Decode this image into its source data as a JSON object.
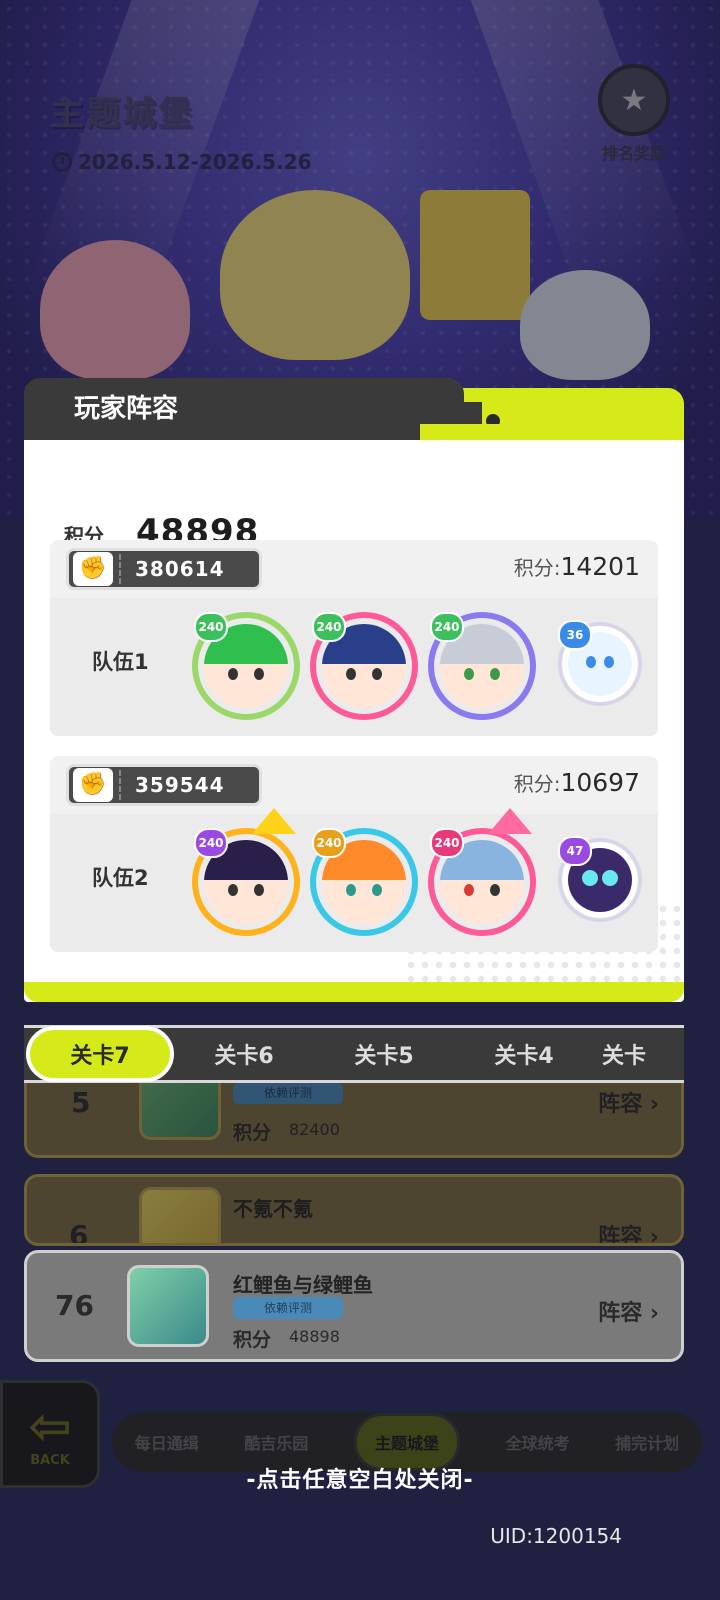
{
  "theme": {
    "title": "主题城堡",
    "date_range": "2026.5.12-2026.5.26",
    "rank_reward_label": "排名奖励"
  },
  "modal": {
    "title": "玩家阵容",
    "total_score_label": "积分",
    "total_score": "48898",
    "teams": [
      {
        "player_id": "380614",
        "score_label": "积分:",
        "score": "14201",
        "name": "队伍1",
        "members": [
          {
            "level": "240",
            "ring_color": "#9ad86a",
            "hair_color": "#2fbf4f"
          },
          {
            "level": "240",
            "ring_color": "#ff5a98",
            "hair_color": "#2a3f8a"
          },
          {
            "level": "240",
            "ring_color": "#8a7af0",
            "hair_color": "#c8ccd6"
          }
        ],
        "pet": {
          "level": "36",
          "color": "#3a8ae8"
        }
      },
      {
        "player_id": "359544",
        "score_label": "积分:",
        "score": "10697",
        "name": "队伍2",
        "members": [
          {
            "level": "240",
            "ring_color": "#ffb21a",
            "hair_color": "#2a1f4a",
            "crown": "gold"
          },
          {
            "level": "240",
            "ring_color": "#3ac8e8",
            "hair_color": "#ff8a2a"
          },
          {
            "level": "240",
            "ring_color": "#ff5a98",
            "hair_color": "#8ab4e0",
            "crown": "pink"
          }
        ],
        "pet": {
          "level": "47",
          "color": "#9a4ae0"
        }
      }
    ]
  },
  "stage_tabs": [
    "关卡7",
    "关卡6",
    "关卡5",
    "关卡4",
    "关卡"
  ],
  "ranking": [
    {
      "rank": "5",
      "name": "",
      "score_label": "积分",
      "score": "82400",
      "tag": "依赖评测",
      "lineup_label": "阵容"
    },
    {
      "rank": "6",
      "name": "不氪不氪",
      "score_label": "",
      "score": "",
      "tag": "",
      "lineup_label": "阵容"
    },
    {
      "rank": "76",
      "name": "红鲤鱼与绿鲤鱼",
      "score_label": "积分",
      "score": "48898",
      "tag": "依赖评测",
      "lineup_label": "阵容"
    }
  ],
  "back_label": "BACK",
  "bottom_nav": [
    "每日通缉",
    "酷吉乐园",
    "主题城堡",
    "全球统考",
    "捕完计划"
  ],
  "close_hint": "-点击任意空白处关闭-",
  "uid": "UID:1200154",
  "colors": {
    "accent": "#d6ea1a",
    "dark": "#3a3a3a"
  }
}
